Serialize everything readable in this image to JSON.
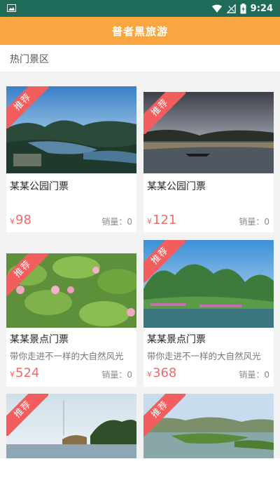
{
  "status_bar": {
    "time": "9:24",
    "icons": [
      "image-icon",
      "wifi-icon",
      "signal-icon",
      "battery-icon"
    ]
  },
  "app_bar": {
    "title": "普者黑旅游"
  },
  "section": {
    "title": "热门景区"
  },
  "cards": [
    {
      "badge": "推荐",
      "name": "某某公园门票",
      "desc": "",
      "currency": "¥",
      "price": "98",
      "sales": "销量：0"
    },
    {
      "badge": "推荐",
      "name": "某某公园门票",
      "desc": "",
      "currency": "¥",
      "price": "121",
      "sales": "销量：0"
    },
    {
      "badge": "推荐",
      "name": "某某景点门票",
      "desc": "带你走进不一样的大自然风光",
      "currency": "¥",
      "price": "524",
      "sales": "销量：0"
    },
    {
      "badge": "推荐",
      "name": "某某景点门票",
      "desc": "带你走进不一样的大自然风光",
      "currency": "¥",
      "price": "368",
      "sales": "销量：0"
    },
    {
      "badge": "推荐"
    },
    {
      "badge": "推荐"
    }
  ],
  "colors": {
    "status_bar": "#1f6b5a",
    "app_bar": "#f9a640",
    "badge": "#f25d5d",
    "price": "#f06a6a",
    "background": "#f2f2f2"
  }
}
